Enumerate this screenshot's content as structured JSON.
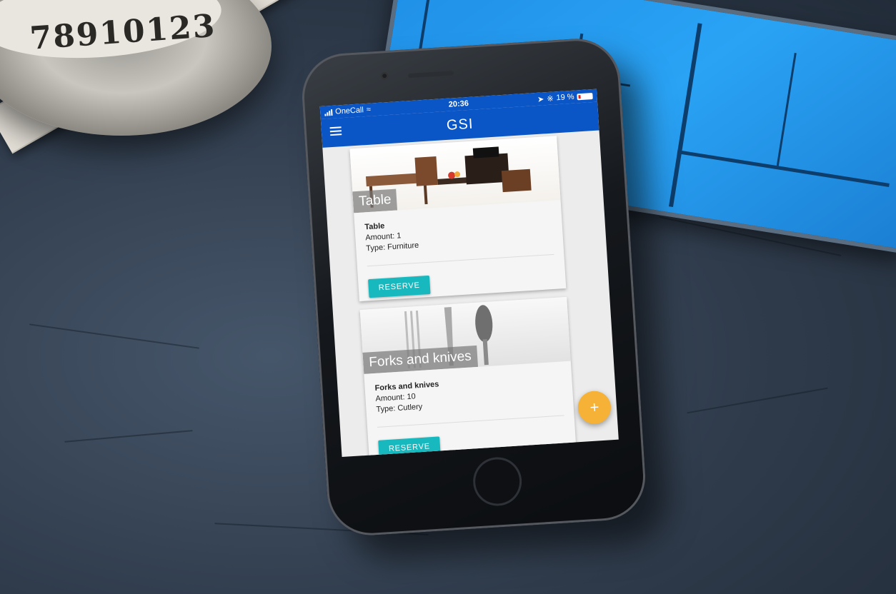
{
  "status_bar": {
    "carrier": "OneCall",
    "time": "20:36",
    "battery": "19 %"
  },
  "app_bar": {
    "title": "GSI",
    "menu_icon": "hamburger-menu-icon"
  },
  "items": [
    {
      "image_caption": "Table",
      "name": "Table",
      "amount": "Amount: 1",
      "type": "Type: Furniture",
      "action_label": "RESERVE"
    },
    {
      "image_caption": "Forks and knives",
      "name": "Forks and knives",
      "amount": "Amount: 10",
      "type": "Type: Cutlery",
      "action_label": "RESERVE"
    }
  ],
  "fab": {
    "label": "+",
    "icon": "add-icon"
  },
  "colors": {
    "app_bar": "#0b56c7",
    "reserve_button": "#17b8be",
    "fab": "#f6b137"
  }
}
